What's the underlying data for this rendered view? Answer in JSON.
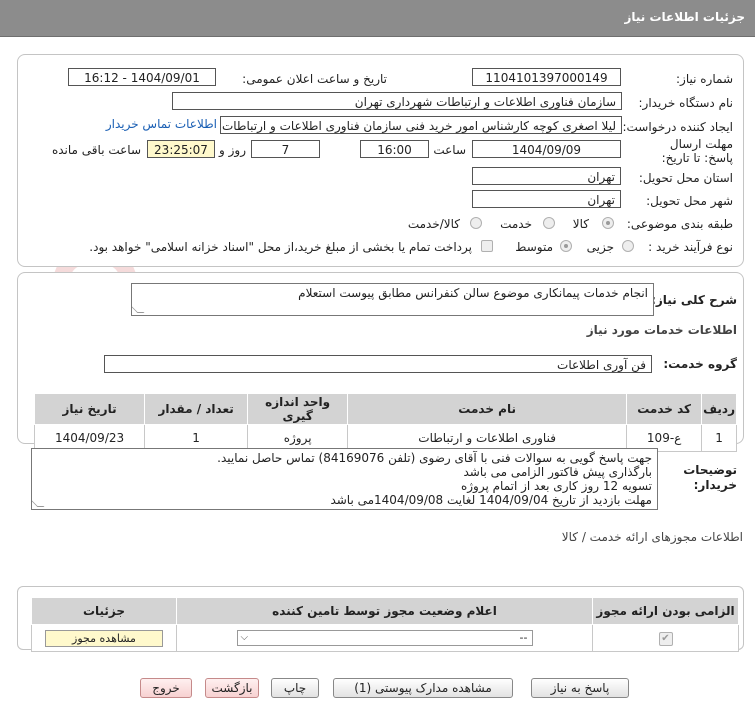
{
  "header": {
    "title": "جزئیات اطلاعات نیاز"
  },
  "fields": {
    "need_number_label": "شماره نیاز:",
    "need_number": "1104101397000149",
    "announce_label": "تاریخ و ساعت اعلان عمومی:",
    "announce_value": "1404/09/01 - 16:12",
    "buyer_org_label": "نام دستگاه خریدار:",
    "buyer_org": "سازمان فناوری اطلاعات و ارتباطات شهرداری تهران",
    "creator_label": "ایجاد کننده درخواست:",
    "creator": "لیلا اصغری کوچه کارشناس امور خرید فنی سازمان فناوری اطلاعات و ارتباطات شهرداری تهران",
    "contact_link": "اطلاعات تماس خریدار",
    "deadline_label": "مهلت ارسال پاسخ: تا تاریخ:",
    "deadline_date": "1404/09/09",
    "time_label": "ساعت",
    "deadline_time": "16:00",
    "days_value": "7",
    "days_label": "روز و",
    "remaining_time": "23:25:07",
    "remaining_label": "ساعت باقی مانده",
    "province_label": "استان محل تحویل:",
    "province": "تهران",
    "city_label": "شهر محل تحویل:",
    "city": "تهران",
    "category_label": "طبقه بندی موضوعی:",
    "category_options": [
      "کالا",
      "خدمت",
      "کالا/خدمت"
    ],
    "process_label": "نوع فرآیند خرید :",
    "process_options": [
      "جزیی",
      "متوسط"
    ],
    "payment_note": "پرداخت تمام یا بخشی از مبلغ خرید،از محل \"اسناد خزانه اسلامی\" خواهد بود."
  },
  "description": {
    "label": "شرح کلی نیاز:",
    "text": "انجام خدمات پیمانکاری موضوع سالن کنفرانس مطابق پیوست استعلام"
  },
  "services": {
    "section_title": "اطلاعات خدمات مورد نیاز",
    "group_label": "گروه خدمت:",
    "group_value": "فن آوری اطلاعات",
    "columns": [
      "ردیف",
      "کد خدمت",
      "نام خدمت",
      "واحد اندازه گیری",
      "تعداد / مقدار",
      "تاریخ نیاز"
    ],
    "rows": [
      [
        "1",
        "ع-109",
        "فناوری اطلاعات و ارتباطات",
        "پروژه",
        "1",
        "1404/09/23"
      ]
    ]
  },
  "buyer_notes": {
    "label": "توضیحات خریدار:",
    "lines": [
      "جهت پاسخ گویی به سوالات فنی با آقای رضوی (تلفن 84169076) تماس حاصل نمایید.",
      "بارگذاری پیش فاکتور الزامی می باشد",
      "تسویه 12 روز کاری بعد از اتمام پروژه",
      "مهلت بازدید از تاریخ 1404/09/04 لغایت 1404/09/08می باشد"
    ]
  },
  "permits": {
    "section_title": "اطلاعات مجوزهای ارائه خدمت / کالا",
    "columns": [
      "الزامی بودن ارائه مجوز",
      "اعلام وضعیت مجوز توسط تامین کننده",
      "جزئیات"
    ],
    "select_value": "--",
    "view_button": "مشاهده مجوز"
  },
  "buttons": {
    "reply": "پاسخ به نیاز",
    "docs": "مشاهده مدارک پیوستی (1)",
    "print": "چاپ",
    "back": "بازگشت",
    "exit": "خروج"
  },
  "watermark": {
    "text": "AriaTender.net"
  }
}
